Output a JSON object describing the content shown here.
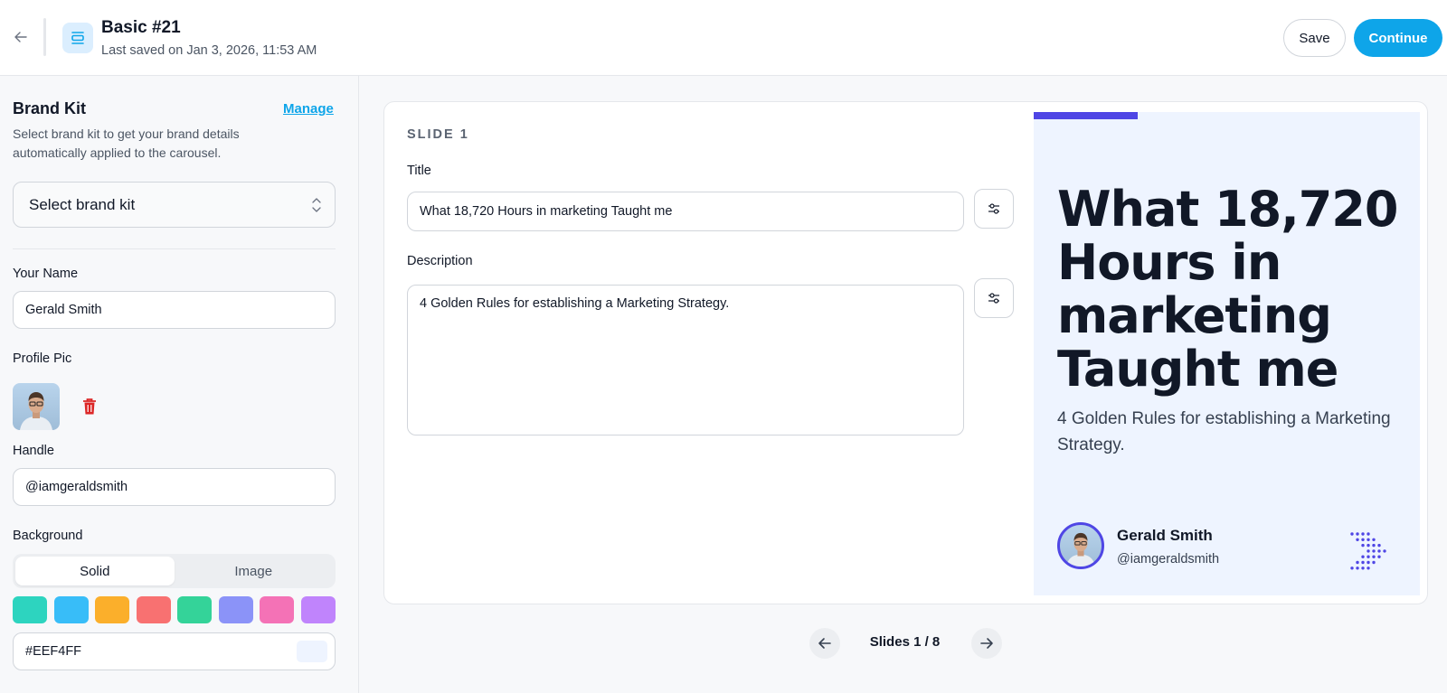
{
  "header": {
    "title": "Basic #21",
    "saved": "Last saved on Jan 3, 2026, 11:53 AM",
    "save_label": "Save",
    "continue_label": "Continue"
  },
  "sidebar": {
    "title": "Brand Kit",
    "manage_label": "Manage",
    "description": "Select brand kit to get your brand details automatically applied to the carousel.",
    "select_placeholder": "Select brand kit",
    "name_label": "Your Name",
    "name_value": "Gerald Smith",
    "profile_pic_label": "Profile Pic",
    "handle_label": "Handle",
    "handle_value": "@iamgeraldsmith",
    "background_label": "Background",
    "bg_tabs": [
      "Solid",
      "Image"
    ],
    "active_bg_tab": "Solid",
    "swatches": [
      "#2dd4bf",
      "#38bdf8",
      "#fbaf2b",
      "#f87171",
      "#34d399",
      "#8b93f8",
      "#f472b6",
      "#c084fc"
    ],
    "color_value": "#EEF4FF"
  },
  "editor": {
    "slide_label": "SLIDE 1",
    "title_label": "Title",
    "title_value": "What 18,720 Hours in marketing Taught me",
    "description_label": "Description",
    "description_value": "4 Golden Rules for establishing a Marketing Strategy."
  },
  "preview": {
    "title": "What 18,720 Hours in marketing Taught me",
    "description": "4 Golden Rules for establishing a Marketing Strategy.",
    "name": "Gerald Smith",
    "handle": "@iamgeraldsmith",
    "background": "#EEF4FF",
    "accent": "#4f46e5"
  },
  "pager": {
    "text": "Slides 1 / 8"
  },
  "icons": {
    "back": "arrow-left-icon",
    "doc": "document-icon",
    "chevron": "chevron-up-down-icon",
    "trash": "trash-icon",
    "options": "sliders-icon",
    "prev": "arrow-left-icon",
    "next": "arrow-right-icon"
  }
}
